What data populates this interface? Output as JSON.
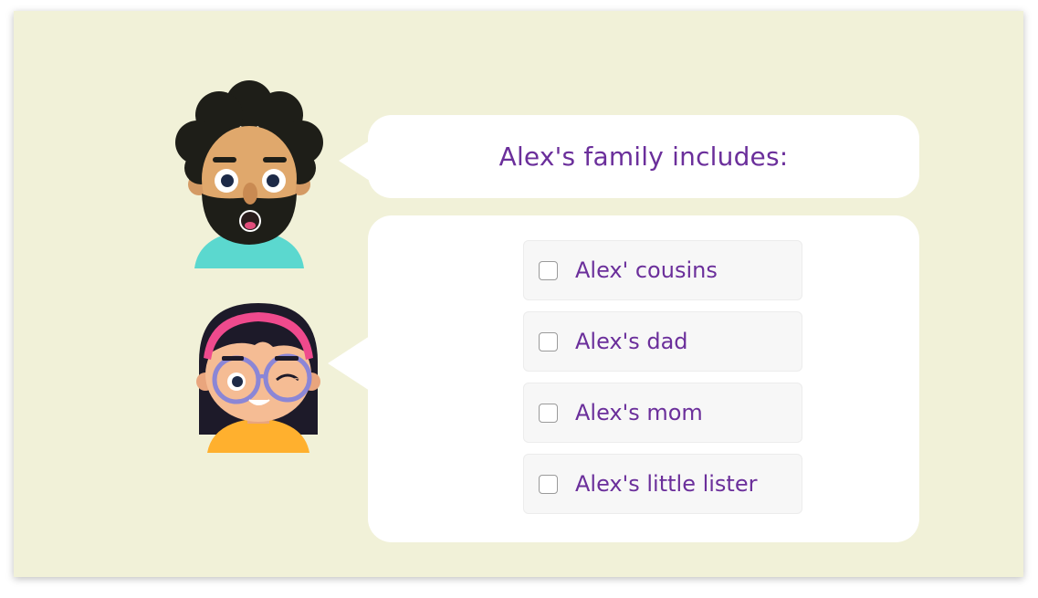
{
  "question": {
    "text": "Alex's family includes:"
  },
  "options": [
    {
      "label": "Alex' cousins",
      "checked": false
    },
    {
      "label": "Alex's dad",
      "checked": false
    },
    {
      "label": "Alex's mom",
      "checked": false
    },
    {
      "label": "Alex's little lister",
      "checked": false
    }
  ],
  "colors": {
    "background": "#f1f1d8",
    "text_accent": "#6b2f9b",
    "bubble": "#ffffff"
  },
  "icons": {
    "dad_avatar": "bearded-man-avatar-icon",
    "girl_avatar": "girl-with-glasses-avatar-icon"
  }
}
